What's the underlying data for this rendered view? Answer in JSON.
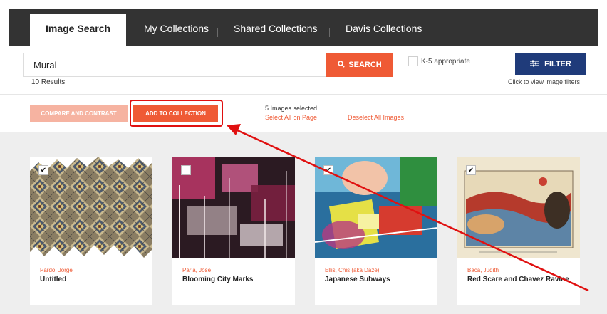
{
  "tabs": [
    {
      "label": "Image Search",
      "active": true
    },
    {
      "label": "My Collections",
      "active": false
    },
    {
      "label": "Shared Collections",
      "active": false
    },
    {
      "label": "Davis Collections",
      "active": false
    }
  ],
  "search": {
    "value": "Mural",
    "button_label": "SEARCH",
    "results": "10 Results"
  },
  "k5": {
    "label": "K-5 appropriate",
    "checked": false
  },
  "filter": {
    "label": "FILTER",
    "hint": "Click to view image filters"
  },
  "actions": {
    "compare_label": "COMPARE AND CONTRAST",
    "add_label": "ADD TO COLLECTION",
    "selected_count": "5 Images selected",
    "select_all": "Select All on Page",
    "deselect_all": "Deselect All Images"
  },
  "cards": [
    {
      "artist": "Pardo, Jorge",
      "title": "Untitled",
      "checked": true
    },
    {
      "artist": "Parlá, José",
      "title": "Blooming City Marks",
      "checked": false
    },
    {
      "artist": "Ellis, Chis (aka Daze)",
      "title": "Japanese Subways",
      "checked": true
    },
    {
      "artist": "Baca, Judith",
      "title": "Red Scare and Chavez Ravine",
      "checked": true
    }
  ],
  "colors": {
    "accent": "#ef5a35",
    "filter_blue": "#1f3b7a",
    "annotation_red": "#e01010"
  }
}
